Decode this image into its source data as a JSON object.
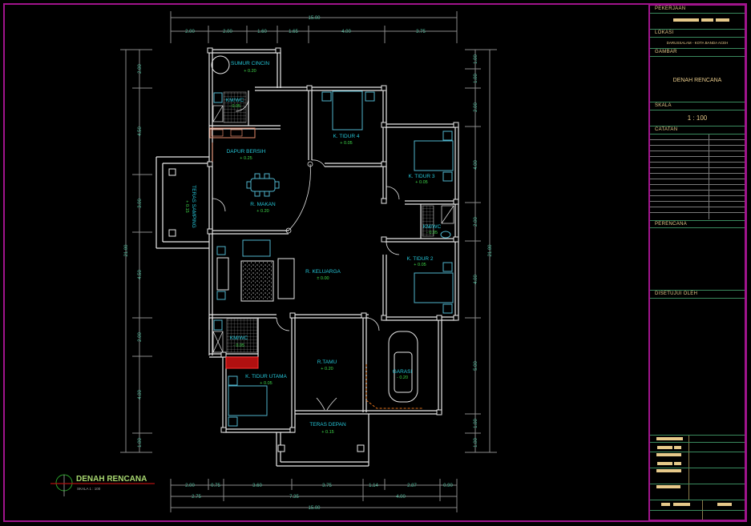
{
  "drawing": {
    "title": "DENAH RENCANA",
    "scale_caption": "SKALA  1 : 100",
    "overall_width": "15.00",
    "overall_depth": "21.00",
    "top_dims": [
      "2.00",
      "2.00",
      "1.60",
      "1.65",
      "4.00",
      "3.75"
    ],
    "bottom_dims_row1": [
      "2.00",
      "0.75",
      "3.60",
      "3.75",
      "1.14",
      "2.87",
      "0.90"
    ],
    "bottom_dims_row2": [
      "2.75",
      "7.35",
      "4.00"
    ],
    "left_dims": [
      "2.00",
      "4.50",
      "3.00",
      "4.50",
      "2.00",
      "4.00",
      "1.00"
    ],
    "right_dims": [
      "1.00",
      "1.00",
      "2.00",
      "4.00",
      "2.00",
      "4.00",
      "5.00",
      "1.00",
      "1.00"
    ],
    "rooms": [
      {
        "name": "SUMUR CINCIN",
        "level": "+ 0.20"
      },
      {
        "name": "KM/WC",
        "level": "- 0.05"
      },
      {
        "name": "DAPUR BERSIH",
        "level": "+ 0.25"
      },
      {
        "name": "R. MAKAN",
        "level": "+ 0.20"
      },
      {
        "name": "TERAS SAMPING",
        "level": "+ 0.15"
      },
      {
        "name": "K. TIDUR 4",
        "level": "+ 0.05"
      },
      {
        "name": "K. TIDUR 3",
        "level": "+ 0.05"
      },
      {
        "name": "KM/WC",
        "level": "- 0.05"
      },
      {
        "name": "K. TIDUR 2",
        "level": "+ 0.05"
      },
      {
        "name": "R. KELUARGA",
        "level": "± 0.00"
      },
      {
        "name": "KM/WC",
        "level": "- 0.05"
      },
      {
        "name": "K. TIDUR UTAMA",
        "level": "+ 0.05"
      },
      {
        "name": "R.TAMU",
        "level": "+ 0.20"
      },
      {
        "name": "GARASI",
        "level": "- 0.20"
      },
      {
        "name": "TERAS DEPAN",
        "level": "+ 0.15"
      }
    ]
  },
  "title_block": {
    "pekerjaan_label": "PEKERJAAN",
    "lokasi_label": "LOKASI",
    "lokasi_value": "DARUSSALAM - KOTA BANDA ACEH",
    "gambar_label": "GAMBAR",
    "gambar_value": "DENAH RENCANA",
    "skala_label": "SKALA",
    "skala_value": "1 : 100",
    "catatan_label": "CATATAN",
    "perencana_label": "PERENCANA",
    "disetujui_label": "DISETUJUI OLEH"
  },
  "colors": {
    "border": "#a0148c",
    "room_label": "#25c6d8",
    "level_label": "#3fd84a",
    "dimension_text": "#4fb89a",
    "wall": "#e8e8e8",
    "title_text": "#e6c98a"
  }
}
